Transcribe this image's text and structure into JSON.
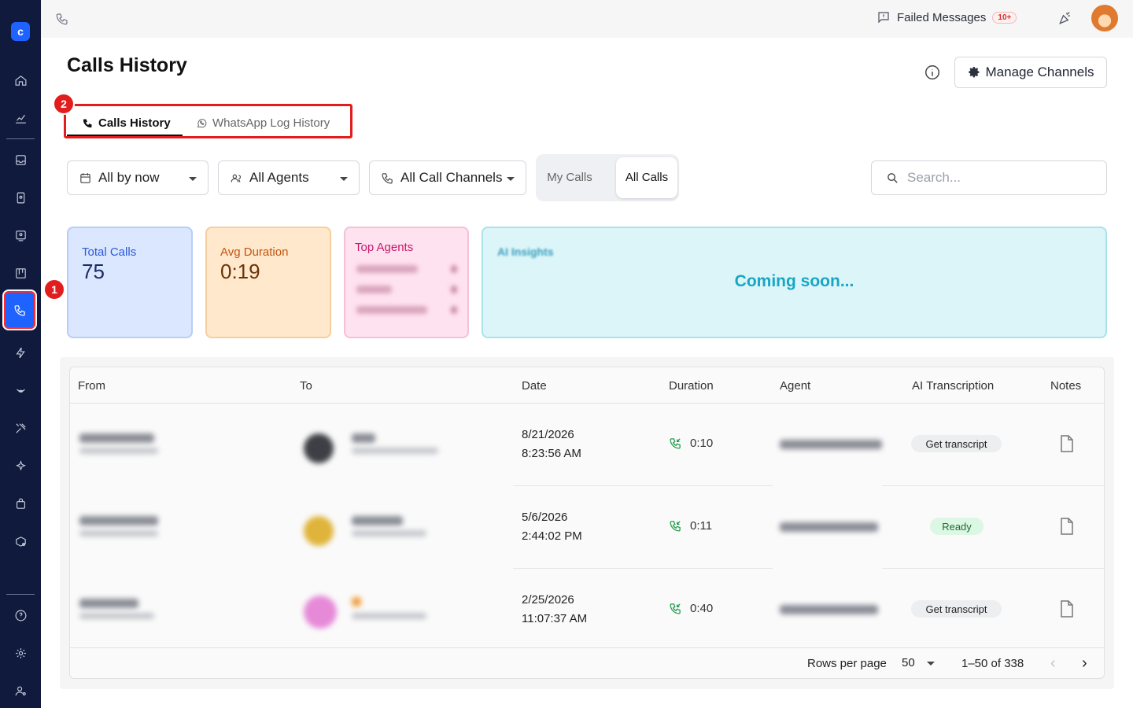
{
  "topbar": {
    "failed_label": "Failed Messages",
    "failed_badge": "10+"
  },
  "header": {
    "title": "Calls History",
    "manage_label": "Manage Channels"
  },
  "tabs": [
    {
      "label": "Calls History",
      "active": true
    },
    {
      "label": "WhatsApp Log History",
      "active": false
    }
  ],
  "steps": {
    "one": "1",
    "two": "2"
  },
  "filters": {
    "date": "All by now",
    "agents": "All Agents",
    "channels": "All Call Channels",
    "toggle_my": "My Calls",
    "toggle_all": "All Calls",
    "search_placeholder": "Search..."
  },
  "stats": {
    "total_label": "Total Calls",
    "total_value": "75",
    "avg_label": "Avg Duration",
    "avg_value": "0:19",
    "top_label": "Top Agents",
    "ai_label": "AI Insights",
    "ai_soon": "Coming soon..."
  },
  "table": {
    "columns": [
      "From",
      "To",
      "Date",
      "Duration",
      "Agent",
      "AI Transcription",
      "Notes"
    ],
    "rows": [
      {
        "date": "8/21/2026",
        "time": "8:23:56 AM",
        "duration": "0:10",
        "transcription": "Get transcript"
      },
      {
        "date": "5/6/2026",
        "time": "2:44:02 PM",
        "duration": "0:11",
        "transcription": "Ready"
      },
      {
        "date": "2/25/2026",
        "time": "11:07:37 AM",
        "duration": "0:40",
        "transcription": "Get transcript"
      }
    ],
    "rows_per_page_label": "Rows per page",
    "rows_per_page": "50",
    "range": "1–50 of 338"
  },
  "colors": {
    "sidebar": "#0f1a3c",
    "accent": "#1e63ff",
    "highlight": "#e11d1d"
  }
}
